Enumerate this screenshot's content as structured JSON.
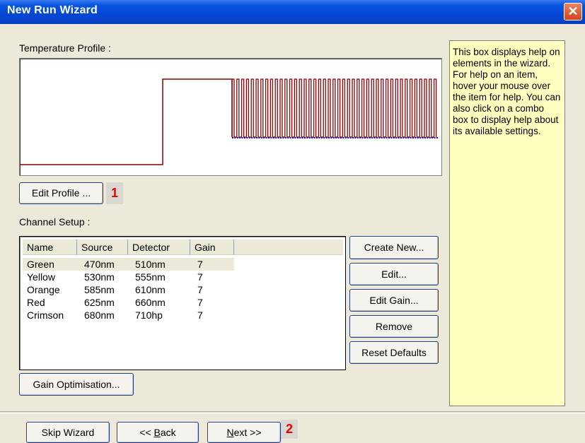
{
  "window": {
    "title": "New Run Wizard"
  },
  "temperature_profile": {
    "label": "Temperature Profile :",
    "edit_button": "Edit Profile ...",
    "marker": "1"
  },
  "channel_setup": {
    "label": "Channel Setup :",
    "columns": [
      "Name",
      "Source",
      "Detector",
      "Gain"
    ],
    "rows": [
      {
        "name": "Green",
        "source": "470nm",
        "detector": "510nm",
        "gain": "7"
      },
      {
        "name": "Yellow",
        "source": "530nm",
        "detector": "555nm",
        "gain": "7"
      },
      {
        "name": "Orange",
        "source": "585nm",
        "detector": "610nm",
        "gain": "7"
      },
      {
        "name": "Red",
        "source": "625nm",
        "detector": "660nm",
        "gain": "7"
      },
      {
        "name": "Crimson",
        "source": "680nm",
        "detector": "710hp",
        "gain": "7"
      }
    ],
    "buttons": {
      "create_new": "Create New...",
      "edit": "Edit...",
      "edit_gain": "Edit Gain...",
      "remove": "Remove",
      "reset_defaults": "Reset Defaults"
    },
    "gain_optimisation": "Gain Optimisation..."
  },
  "help": {
    "text": "This box displays help on elements in the wizard. For help on an item, hover your mouse over the item for help. You can also click on a combo box to display help about its available settings."
  },
  "footer": {
    "skip": "Skip Wizard",
    "back_prefix": "<< ",
    "back_key": "B",
    "back_rest": "ack",
    "next_key": "N",
    "next_rest": "ext >>",
    "marker": "2"
  },
  "colors": {
    "profile_line": "#8b0000",
    "cycle_dots": "#1010a0",
    "help_bg": "#ffffc0"
  }
}
